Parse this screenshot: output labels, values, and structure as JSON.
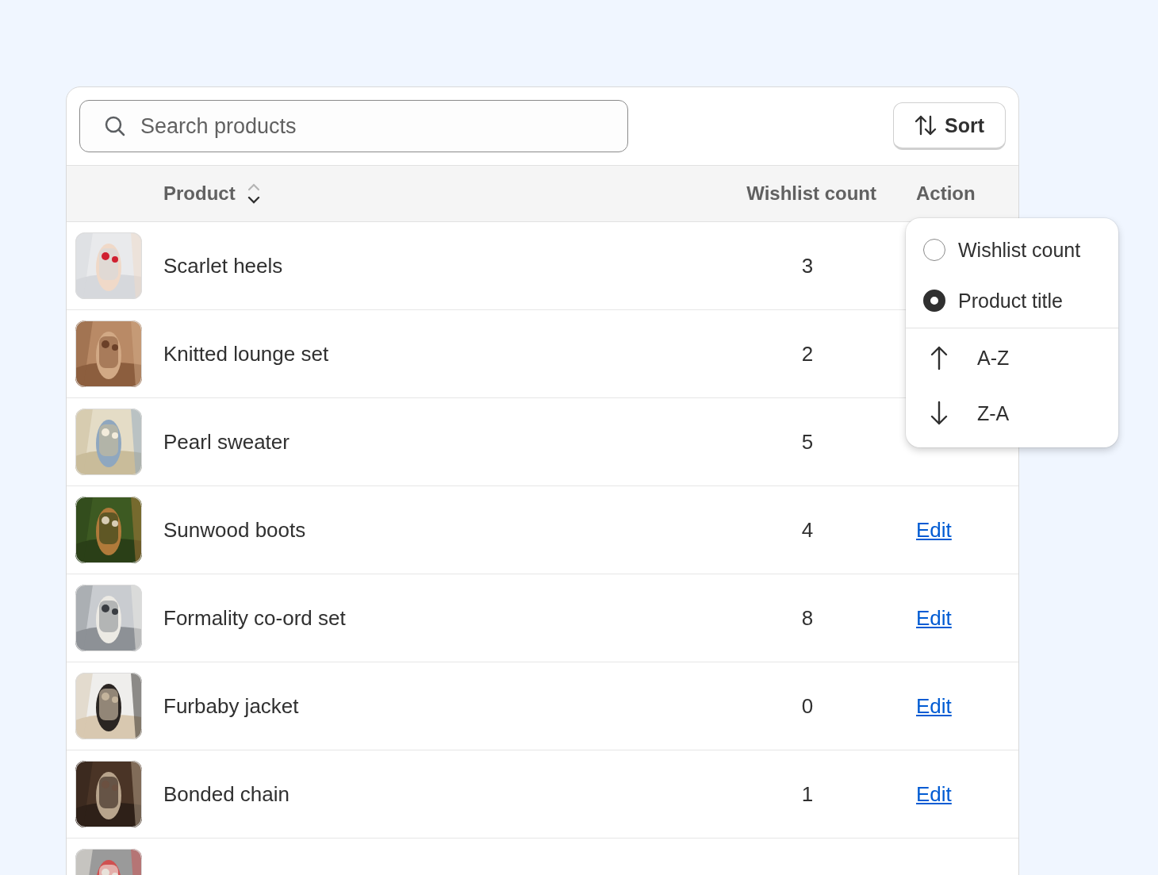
{
  "search": {
    "placeholder": "Search products"
  },
  "sort_button": {
    "label": "Sort"
  },
  "table": {
    "columns": [
      "Product",
      "Wishlist count",
      "Action"
    ],
    "rows": [
      {
        "name": "Scarlet heels",
        "count": "3",
        "thumbnail": {
          "kind": "picture"
        }
      },
      {
        "name": "Knitted lounge set",
        "count": "2",
        "thumbnail": {
          "kind": "picture"
        }
      },
      {
        "name": "Pearl sweater",
        "count": "5",
        "thumbnail": {
          "kind": "picture"
        }
      },
      {
        "name": "Sunwood boots",
        "count": "4",
        "action": "Edit",
        "thumbnail": {
          "kind": "picture"
        }
      },
      {
        "name": "Formality co-ord set",
        "count": "8",
        "action": "Edit",
        "thumbnail": {
          "kind": "picture"
        }
      },
      {
        "name": "Furbaby jacket",
        "count": "0",
        "action": "Edit",
        "thumbnail": {
          "kind": "picture"
        }
      },
      {
        "name": "Bonded chain",
        "count": "1",
        "action": "Edit",
        "thumbnail": {
          "kind": "picture"
        }
      },
      {
        "thumbnail": {
          "kind": "picture"
        }
      }
    ]
  },
  "sort_menu": {
    "options": [
      {
        "kind": "radio",
        "label": "Wishlist count",
        "selected": false
      },
      {
        "kind": "radio",
        "label": "Product title",
        "selected": true
      },
      {
        "kind": "ascending",
        "label": "A-Z"
      },
      {
        "kind": "descending",
        "label": "Z-A"
      }
    ]
  }
}
